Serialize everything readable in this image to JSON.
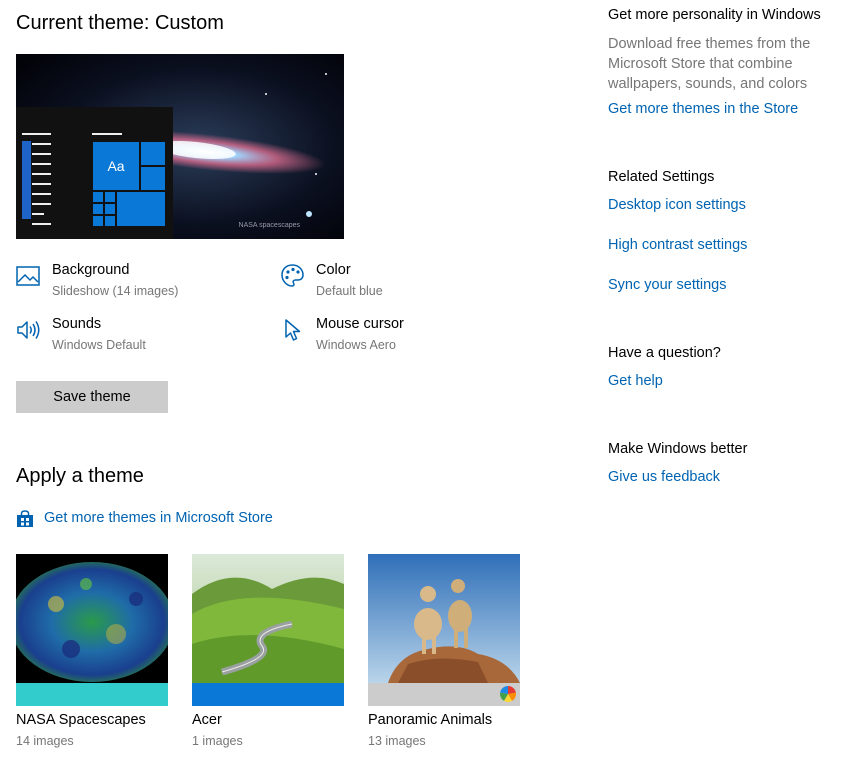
{
  "current_theme": {
    "title": "Current theme: Custom"
  },
  "preview": {
    "tile_text": "Aa",
    "watermark": "NASA spacescapes"
  },
  "settings": [
    {
      "key": "background",
      "label": "Background",
      "value": "Slideshow (14 images)",
      "icon": "picture-icon"
    },
    {
      "key": "color",
      "label": "Color",
      "value": "Default blue",
      "icon": "palette-icon"
    },
    {
      "key": "sounds",
      "label": "Sounds",
      "value": "Windows Default",
      "icon": "speaker-icon"
    },
    {
      "key": "mouse",
      "label": "Mouse cursor",
      "value": "Windows Aero",
      "icon": "cursor-icon"
    }
  ],
  "save_button": "Save theme",
  "apply": {
    "title": "Apply a theme",
    "store_link": "Get more themes in Microsoft Store",
    "themes": [
      {
        "name": "NASA Spacescapes",
        "count": "14 images",
        "accent": "#33cccc"
      },
      {
        "name": "Acer",
        "count": "1 images",
        "accent": "#0a78d7"
      },
      {
        "name": "Panoramic Animals",
        "count": "13 images",
        "accent": "#cccccc"
      }
    ]
  },
  "sidebar": {
    "personality": {
      "heading": "Get more personality in Windows",
      "description": "Download free themes from the Microsoft Store that combine wallpapers, sounds, and colors",
      "link": "Get more themes in the Store"
    },
    "related": {
      "heading": "Related Settings",
      "links": [
        "Desktop icon settings",
        "High contrast settings",
        "Sync your settings"
      ]
    },
    "question": {
      "heading": "Have a question?",
      "link": "Get help"
    },
    "better": {
      "heading": "Make Windows better",
      "link": "Give us feedback"
    }
  },
  "colors": {
    "accent": "#0063b1",
    "tile_blue": "#0a78d7"
  }
}
